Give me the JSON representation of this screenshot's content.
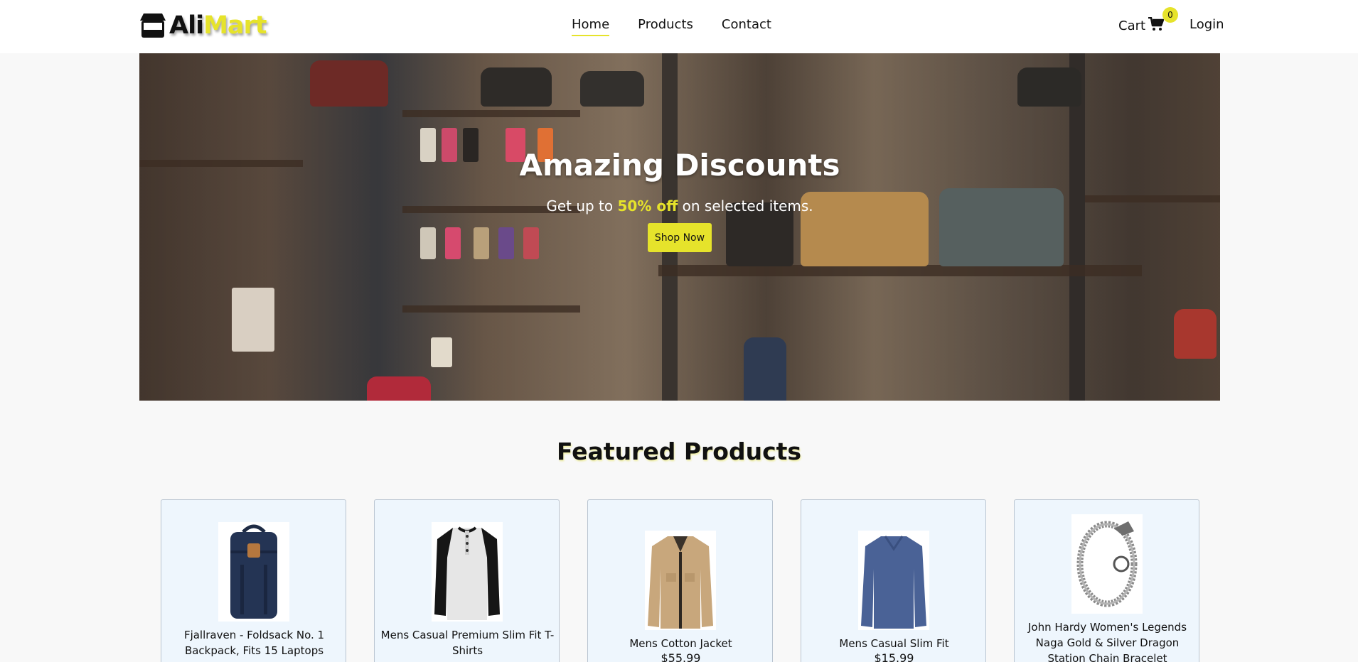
{
  "brand": {
    "part1": "Ali",
    "part2": "Mart",
    "accent": "#e6e32b"
  },
  "nav": {
    "items": [
      {
        "label": "Home"
      },
      {
        "label": "Products"
      },
      {
        "label": "Contact"
      }
    ]
  },
  "cart": {
    "label": "Cart",
    "count": "0"
  },
  "login": {
    "label": "Login"
  },
  "hero": {
    "title": "Amazing Discounts",
    "sub_before": "Get up to ",
    "sub_highlight": "50% off",
    "sub_after": " on selected items.",
    "button": "Shop Now"
  },
  "featured": {
    "title": "Featured Products",
    "products": [
      {
        "title": "Fjallraven - Foldsack No. 1 Backpack, Fits 15 Laptops",
        "price": ""
      },
      {
        "title": "Mens Casual Premium Slim Fit T-Shirts",
        "price": ""
      },
      {
        "title": "Mens Cotton Jacket",
        "price": "$55.99"
      },
      {
        "title": "Mens Casual Slim Fit",
        "price": "$15.99"
      },
      {
        "title": "John Hardy Women's Legends Naga Gold & Silver Dragon Station Chain Bracelet",
        "price": ""
      }
    ]
  }
}
